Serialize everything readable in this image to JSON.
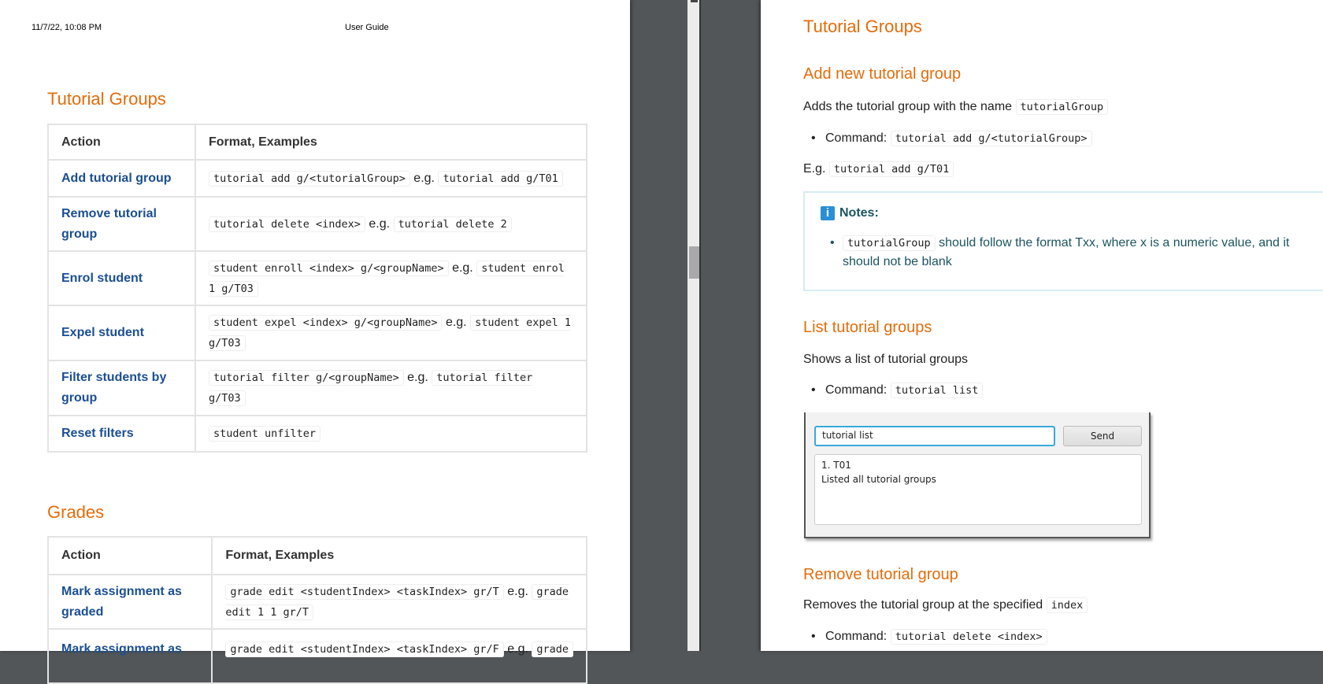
{
  "left_page": {
    "header_datetime": "11/7/22, 10:08 PM",
    "header_title": "User Guide",
    "section1_title": "Tutorial Groups",
    "table1": {
      "headers": [
        "Action",
        "Format, Examples"
      ],
      "rows": [
        {
          "action": "Add tutorial group",
          "format": "tutorial add g/<tutorialGroup>",
          "eg": "e.g.",
          "example": "tutorial add g/T01"
        },
        {
          "action": "Remove tutorial group",
          "format": "tutorial delete <index>",
          "eg": "e.g.",
          "example": "tutorial delete 2"
        },
        {
          "action": "Enrol student",
          "format": "student enroll <index> g/<groupName>",
          "eg": "e.g.",
          "example": "student enrol 1 g/T03"
        },
        {
          "action": "Expel student",
          "format": "student expel <index> g/<groupName>",
          "eg": "e.g.",
          "example": "student expel 1 g/T03"
        },
        {
          "action": "Filter students by group",
          "format": "tutorial filter g/<groupName>",
          "eg": "e.g.",
          "example": "tutorial filter g/T03"
        },
        {
          "action": "Reset filters",
          "format": "student unfilter"
        }
      ]
    },
    "section2_title": "Grades",
    "table2": {
      "headers": [
        "Action",
        "Format, Examples"
      ],
      "rows": [
        {
          "action": "Mark assignment as graded",
          "format": "grade edit <studentIndex> <taskIndex> gr/T",
          "eg": "e.g.",
          "example": "grade edit 1 1 gr/T"
        },
        {
          "action": "Mark assignment as",
          "format": "grade edit <studentIndex> <taskIndex> gr/F",
          "eg": "e.g.",
          "example": "grade"
        }
      ]
    }
  },
  "right_page": {
    "title": "Tutorial Groups",
    "add": {
      "title": "Add new tutorial group",
      "desc": "Adds the tutorial group with the name",
      "desc_code": "tutorialGroup",
      "cmd_label": "Command:",
      "cmd": "tutorial add g/<tutorialGroup>",
      "eg_label": "E.g.",
      "eg": "tutorial add g/T01"
    },
    "notes": {
      "title": "Notes:",
      "code": "tutorialGroup",
      "text": "should follow the format Txx, where x is a numeric value, and it should not be blank"
    },
    "list": {
      "title": "List tutorial groups",
      "desc": "Shows a list of tutorial groups",
      "cmd_label": "Command:",
      "cmd": "tutorial list",
      "app": {
        "input": "tutorial list",
        "send": "Send",
        "output_line1": "1. T01",
        "output_line2": "Listed all tutorial groups"
      }
    },
    "remove": {
      "title": "Remove tutorial group",
      "desc": "Removes the tutorial group at the specified",
      "desc_code": "index",
      "cmd_label": "Command:",
      "cmd": "tutorial delete <index>"
    }
  },
  "colors": {
    "heading": "#e46c0a",
    "action_link": "#1a4f93",
    "notes_text": "#1b5560",
    "viewer_bg": "#525659"
  }
}
